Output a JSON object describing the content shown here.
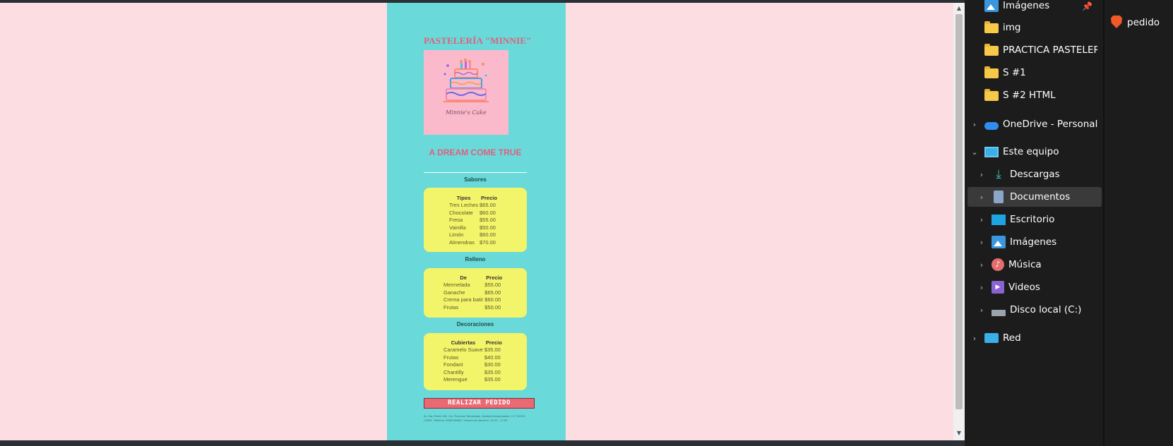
{
  "page": {
    "title": "PASTELERÍA \"MINNIE\"",
    "logo_caption": "Minnie's Cake",
    "slogan": "A DREAM COME TRUE",
    "colors": {
      "background": "#fcdde2",
      "page": "#6ad9d9",
      "box": "#f2f46a",
      "title": "#e0607a",
      "button": "#ea6a74"
    },
    "sections": [
      {
        "title": "Sabores",
        "headers": [
          "Tipos",
          "Precio"
        ],
        "rows": [
          [
            "Tres Leches",
            "$65.00"
          ],
          [
            "Chocolate",
            "$60.00"
          ],
          [
            "Fresa",
            "$55.00"
          ],
          [
            "Vainilla",
            "$50.00"
          ],
          [
            "Limón",
            "$60.00"
          ],
          [
            "Almendras",
            "$70.00"
          ]
        ]
      },
      {
        "title": "Relleno",
        "headers": [
          "De",
          "Precio"
        ],
        "rows": [
          [
            "Mermelada",
            "$55.00"
          ],
          [
            "Ganache",
            "$65.00"
          ],
          [
            "Crema para batir",
            "$60.00"
          ],
          [
            "Frutas",
            "$50.00"
          ]
        ]
      },
      {
        "title": "Decoraciones",
        "headers": [
          "Cubiertas",
          "Precio"
        ],
        "rows": [
          [
            "Caramelo Suave",
            "$35.00"
          ],
          [
            "Frutas",
            "$40.00"
          ],
          [
            "Fondant",
            "$30.00"
          ],
          [
            "Chantilly",
            "$35.00"
          ],
          [
            "Merengue",
            "$35.00"
          ]
        ]
      }
    ],
    "button_label": "REALIZAR PEDIDO",
    "footer": "Av. San Pablo 180, Col. Reynosa Tamaulipas, Alcaldía Azcapotzalco, C.P. 02200, CDMX. Teléfono: 5558786982 / Horario de atención: 10:00 – 17:00"
  },
  "explorer": {
    "items": [
      {
        "label": "Imágenes",
        "icon": "images-icon",
        "chevron": false,
        "pinned": true
      },
      {
        "label": "img",
        "icon": "folder-icon",
        "chevron": false
      },
      {
        "label": "PRACTICA PASTELERIA",
        "icon": "folder-icon",
        "chevron": false
      },
      {
        "label": "S #1",
        "icon": "folder-icon",
        "chevron": false
      },
      {
        "label": "S #2 HTML",
        "icon": "folder-icon",
        "chevron": false
      },
      {
        "label": "OneDrive - Personal",
        "icon": "onedrive-icon",
        "chevron": "right"
      },
      {
        "label": "Este equipo",
        "icon": "computer-icon",
        "chevron": "down"
      },
      {
        "label": "Descargas",
        "icon": "downloads-icon",
        "chevron": "right"
      },
      {
        "label": "Documentos",
        "icon": "documents-icon",
        "chevron": "right",
        "selected": true
      },
      {
        "label": "Escritorio",
        "icon": "desktop-icon",
        "chevron": "right"
      },
      {
        "label": "Imágenes",
        "icon": "images-icon",
        "chevron": "right"
      },
      {
        "label": "Música",
        "icon": "music-icon",
        "chevron": "right"
      },
      {
        "label": "Videos",
        "icon": "videos-icon",
        "chevron": "right"
      },
      {
        "label": "Disco local (C:)",
        "icon": "drive-icon",
        "chevron": "right"
      },
      {
        "label": "Red",
        "icon": "network-icon",
        "chevron": "right"
      }
    ],
    "file_label": "pedido"
  }
}
